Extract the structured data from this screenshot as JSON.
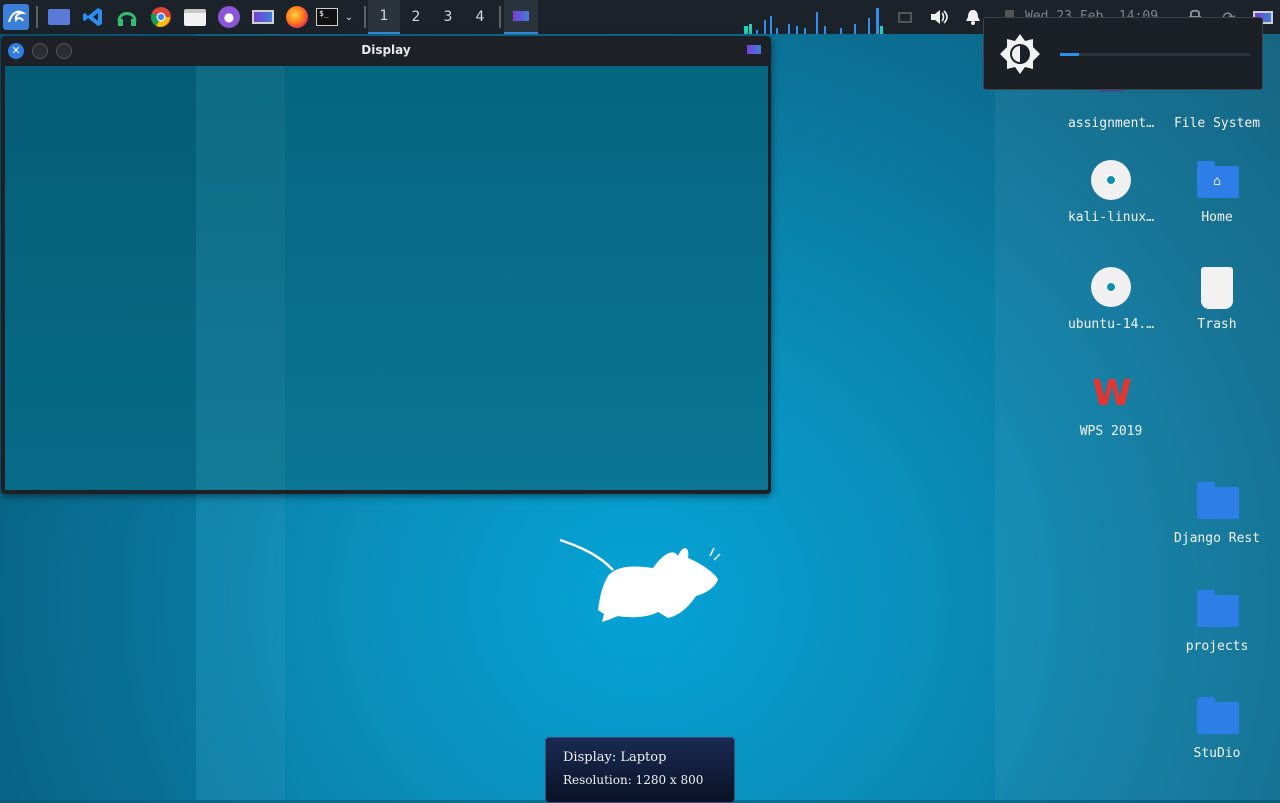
{
  "colors": {
    "accent": "#3a8de0",
    "panel": "#1c2229",
    "desktop": "#0a8cb8"
  },
  "panel": {
    "launchers": [
      {
        "name": "kali-menu-icon"
      },
      {
        "name": "desktop-icon"
      },
      {
        "name": "vscode-icon"
      },
      {
        "name": "headphones-icon"
      },
      {
        "name": "chrome-icon"
      },
      {
        "name": "file-manager-icon"
      },
      {
        "name": "github-icon"
      },
      {
        "name": "display-settings-icon"
      },
      {
        "name": "firefox-icon"
      },
      {
        "name": "terminal-icon"
      }
    ],
    "workspaces": [
      "1",
      "2",
      "3",
      "4"
    ],
    "active_workspace": "1",
    "clock": "Wed 23 Feb, 14:09"
  },
  "window": {
    "title": "Display"
  },
  "brightness": {
    "level_percent": 10,
    "icon": "brightness-icon"
  },
  "desktop_icons": [
    {
      "label": "assignment…",
      "type": "document"
    },
    {
      "label": "File System",
      "type": "drive"
    },
    {
      "label": "kali-linux…",
      "type": "disc"
    },
    {
      "label": "Home",
      "type": "home-folder"
    },
    {
      "label": "ubuntu-14.…",
      "type": "disc"
    },
    {
      "label": "Trash",
      "type": "trash"
    },
    {
      "label": "WPS 2019",
      "type": "wps"
    },
    {
      "label": "Django Rest",
      "type": "folder"
    },
    {
      "label": "projects",
      "type": "folder"
    },
    {
      "label": "StuDio",
      "type": "folder"
    }
  ],
  "notification": {
    "line1": "Display: Laptop",
    "line2": "Resolution: 1280 x 800"
  }
}
